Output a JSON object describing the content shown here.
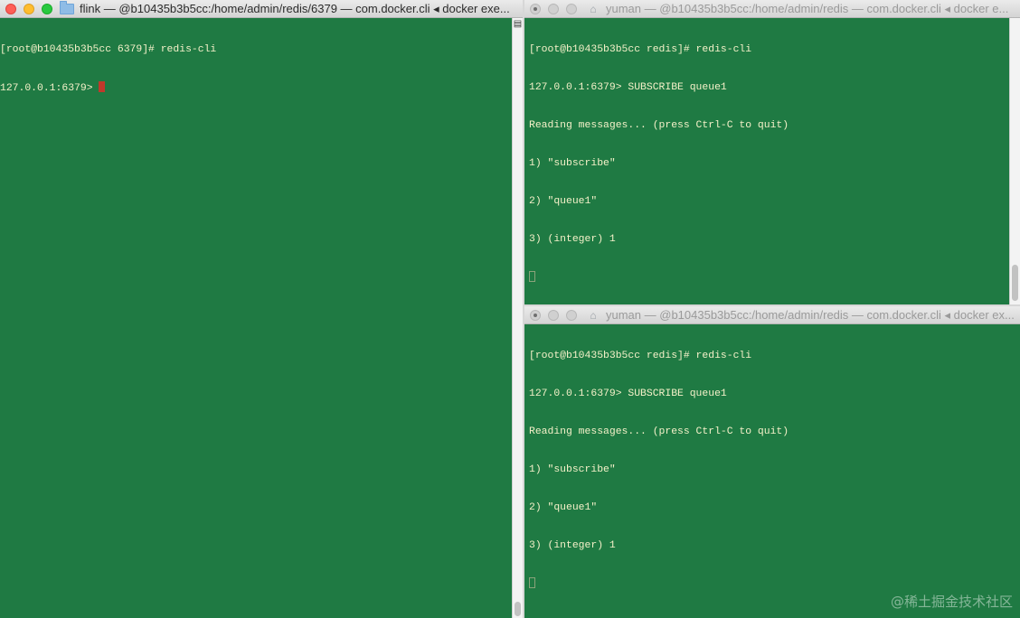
{
  "windows": [
    {
      "title": "flink — @b10435b3b5cc:/home/admin/redis/6379 — com.docker.cli ◂ docker exe...",
      "lines": [
        "[root@b10435b3b5cc 6379]# redis-cli",
        "127.0.0.1:6379> "
      ]
    },
    {
      "title": "yuman — @b10435b3b5cc:/home/admin/redis — com.docker.cli ◂ docker e...",
      "lines": [
        "[root@b10435b3b5cc redis]# redis-cli",
        "127.0.0.1:6379> SUBSCRIBE queue1",
        "Reading messages... (press Ctrl-C to quit)",
        "1) \"subscribe\"",
        "2) \"queue1\"",
        "3) (integer) 1"
      ]
    },
    {
      "title": "yuman — @b10435b3b5cc:/home/admin/redis — com.docker.cli ◂ docker ex...",
      "lines": [
        "[root@b10435b3b5cc redis]# redis-cli",
        "127.0.0.1:6379> SUBSCRIBE queue1",
        "Reading messages... (press Ctrl-C to quit)",
        "1) \"subscribe\"",
        "2) \"queue1\"",
        "3) (integer) 1"
      ]
    }
  ],
  "watermark": "@稀土掘金技术社区",
  "colors": {
    "terminal_bg": "#1f7a43",
    "terminal_fg": "#f5f1c9",
    "cursor_active": "#c0392b"
  },
  "icons": {
    "window1_tab_icon": "folder-icon",
    "window2_tab_icon": "home-icon",
    "window3_tab_icon": "home-icon",
    "split_control": "split-pane-icon"
  }
}
